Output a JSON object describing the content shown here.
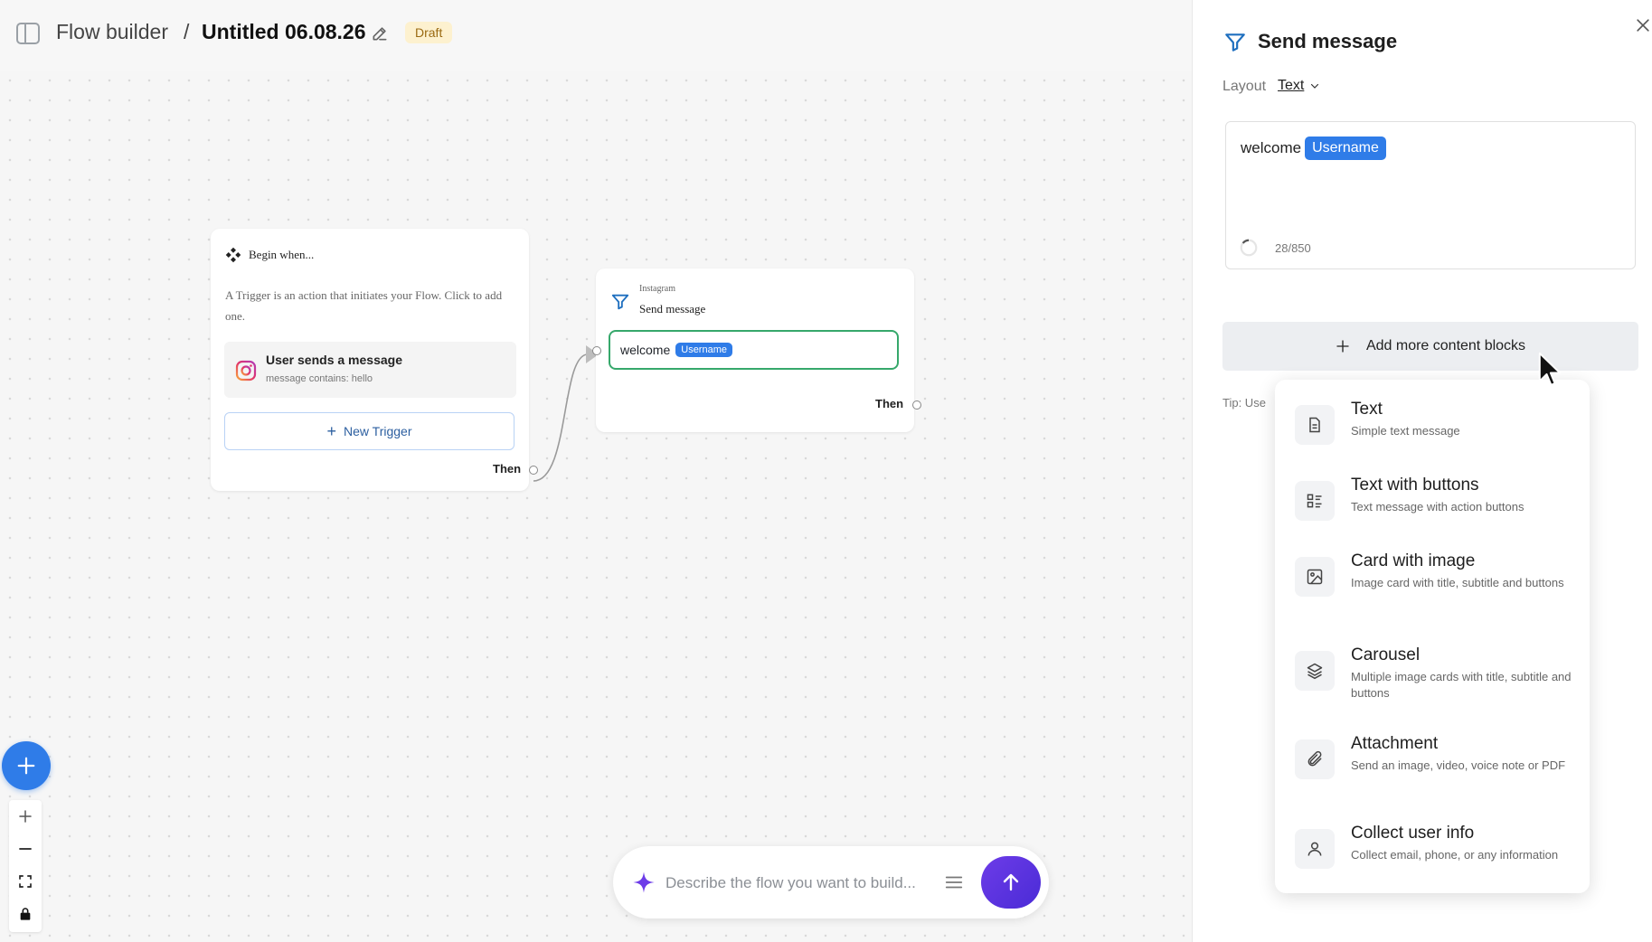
{
  "header": {
    "root": "Flow builder",
    "separator": "/",
    "title": "Untitled 06.08.26",
    "badge": "Draft"
  },
  "trigger_node": {
    "heading": "Begin when...",
    "description": "A Trigger is an action that initiates your Flow. Click to add one.",
    "item_title": "User sends a message",
    "item_subtitle": "message contains: hello",
    "new_trigger_label": "New Trigger",
    "then_label": "Then"
  },
  "message_node": {
    "platform": "Instagram",
    "title": "Send message",
    "text": "welcome",
    "chip": "Username",
    "then_label": "Then"
  },
  "prompt": {
    "placeholder": "Describe the flow you want to build..."
  },
  "panel": {
    "title": "Send message",
    "layout_label": "Layout",
    "layout_value": "Text",
    "editor_text": "welcome",
    "editor_chip": "Username",
    "counter": "28/850",
    "add_blocks_label": "Add more content blocks",
    "tip": "Tip: Use"
  },
  "dropdown": {
    "options": [
      {
        "title": "Text",
        "desc": "Simple text message",
        "icon": "document-icon"
      },
      {
        "title": "Text with buttons",
        "desc": "Text message with action buttons",
        "icon": "list-buttons-icon"
      },
      {
        "title": "Card with image",
        "desc": "Image card with title, subtitle and buttons",
        "icon": "image-icon"
      },
      {
        "title": "Carousel",
        "desc": "Multiple image cards with title, subtitle and buttons",
        "icon": "layers-icon"
      },
      {
        "title": "Attachment",
        "desc": "Send an image, video, voice note or PDF",
        "icon": "paperclip-icon"
      },
      {
        "title": "Collect user info",
        "desc": "Collect email, phone, or any information",
        "icon": "user-icon"
      }
    ]
  },
  "colors": {
    "accent": "#2f7ce8",
    "send_button": "#5a32e0",
    "node_border_active": "#36a86b",
    "draft_badge_bg": "#fdf1cf"
  }
}
